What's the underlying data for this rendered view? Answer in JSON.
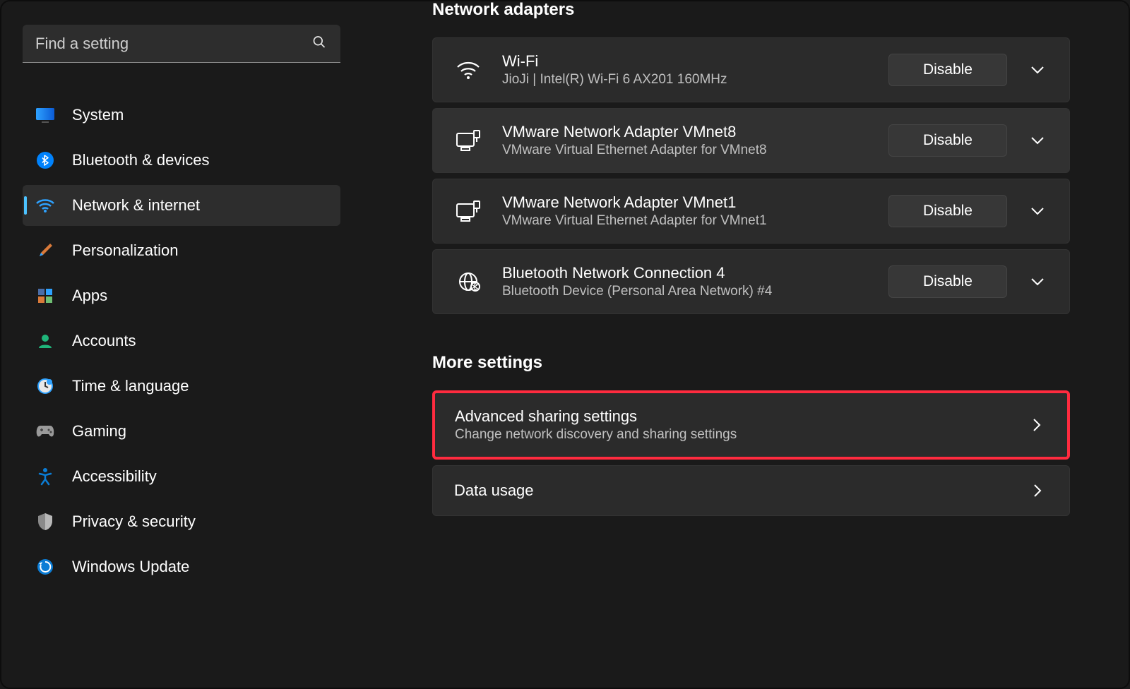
{
  "search": {
    "placeholder": "Find a setting"
  },
  "sidebar": {
    "items": [
      {
        "label": "System",
        "icon": "system"
      },
      {
        "label": "Bluetooth & devices",
        "icon": "bluetooth"
      },
      {
        "label": "Network & internet",
        "icon": "wifi",
        "active": true
      },
      {
        "label": "Personalization",
        "icon": "brush"
      },
      {
        "label": "Apps",
        "icon": "apps"
      },
      {
        "label": "Accounts",
        "icon": "account"
      },
      {
        "label": "Time & language",
        "icon": "clock"
      },
      {
        "label": "Gaming",
        "icon": "gaming"
      },
      {
        "label": "Accessibility",
        "icon": "accessibility"
      },
      {
        "label": "Privacy & security",
        "icon": "shield"
      },
      {
        "label": "Windows Update",
        "icon": "update"
      }
    ]
  },
  "main": {
    "adapters_heading": "Network adapters",
    "adapters": [
      {
        "title": "Wi-Fi",
        "sub": "JioJi | Intel(R) Wi-Fi 6 AX201 160MHz",
        "button": "Disable",
        "icon": "wifi"
      },
      {
        "title": "VMware Network Adapter VMnet8",
        "sub": "VMware Virtual Ethernet Adapter for VMnet8",
        "button": "Disable",
        "icon": "ethernet"
      },
      {
        "title": "VMware Network Adapter VMnet1",
        "sub": "VMware Virtual Ethernet Adapter for VMnet1",
        "button": "Disable",
        "icon": "ethernet"
      },
      {
        "title": "Bluetooth Network Connection 4",
        "sub": "Bluetooth Device (Personal Area Network) #4",
        "button": "Disable",
        "icon": "bt-net"
      }
    ],
    "more_heading": "More settings",
    "more": [
      {
        "title": "Advanced sharing settings",
        "sub": "Change network discovery and sharing settings",
        "highlight": true
      },
      {
        "title": "Data usage",
        "sub": ""
      }
    ]
  }
}
